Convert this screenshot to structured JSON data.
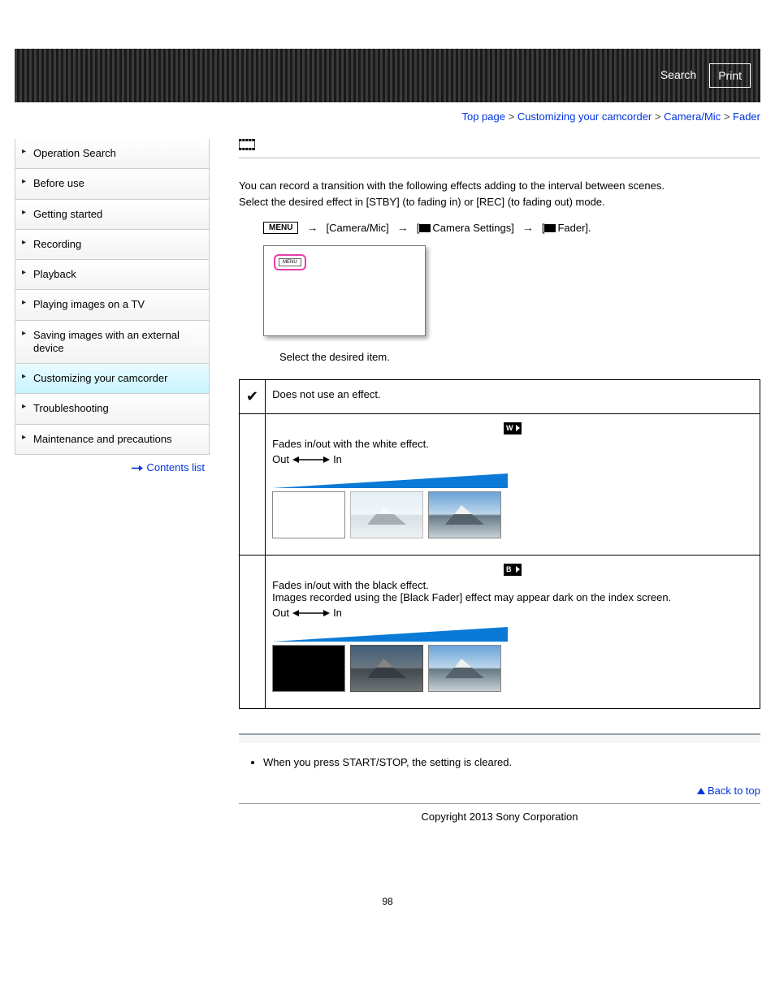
{
  "topbar": {
    "search": "Search",
    "print": "Print"
  },
  "breadcrumb": {
    "top_page": "Top page",
    "customizing": "Customizing your camcorder",
    "camera_mic": "Camera/Mic",
    "current": "Fader"
  },
  "sidebar": {
    "items": [
      "Operation Search",
      "Before use",
      "Getting started",
      "Recording",
      "Playback",
      "Playing images on a TV",
      "Saving images with an external device",
      "Customizing your camcorder",
      "Troubleshooting",
      "Maintenance and precautions"
    ],
    "contents_list": "Contents list"
  },
  "content": {
    "intro1": "You can record a transition with the following effects adding to the interval between scenes.",
    "intro2": "Select the desired effect in [STBY] (to fading in) or [REC] (to fading out) mode.",
    "menu_badge": "MENU",
    "path_camera_mic": "[Camera/Mic]",
    "path_settings": "Camera Settings]",
    "path_fader": "Fader].",
    "select_item": "Select the desired item.",
    "row_off": "Does not use an effect.",
    "row_white_title": "Fades in/out with the white effect.",
    "row_black_title": "Fades in/out with the black effect.",
    "row_black_note": "Images recorded using the [Black Fader] effect may appear dark on the index screen.",
    "out_label": "Out",
    "in_label": "In",
    "note1": "When you press START/STOP, the setting is cleared.",
    "back_to_top": "Back to top",
    "copyright": "Copyright 2013 Sony Corporation",
    "page_number": "98"
  }
}
